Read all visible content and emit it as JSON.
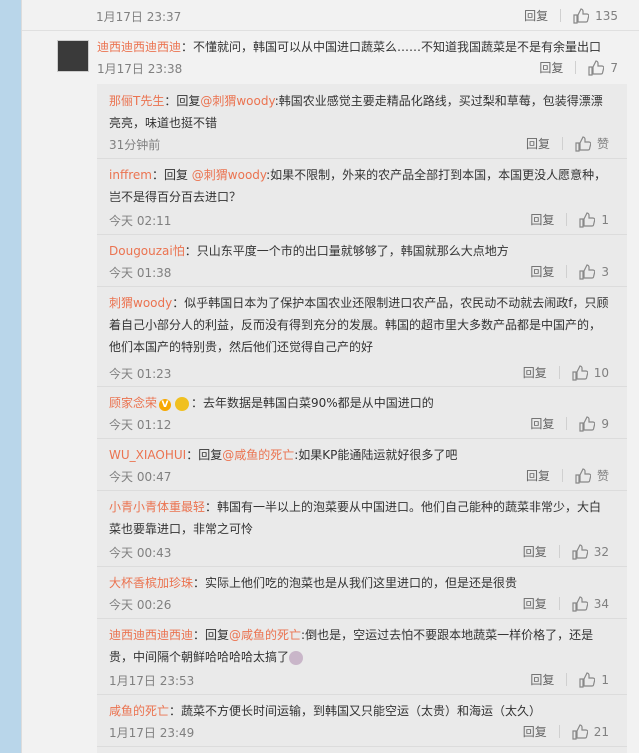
{
  "top": {
    "time": "1月17日 23:37",
    "reply": "回复",
    "likes": "135"
  },
  "main": {
    "user": "迪西迪西迪西迪",
    "text": "：不懂就问，韩国可以从中国进口蔬菜么……不知道我国蔬菜是不是有余量出口",
    "time": "1月17日 23:38",
    "reply": "回复",
    "likes": "7"
  },
  "replies": [
    {
      "user": "那俪T先生",
      "prefix": "：回复",
      "mention": "@刺猬woody",
      "text": ":韩国农业感觉主要走精品化路线，买过梨和草莓，包装得漂漂亮亮，味道也挺不错",
      "time": "31分钟前",
      "reply": "回复",
      "likes": "赞"
    },
    {
      "user": "inffrem",
      "prefix": "：回复 ",
      "mention": "@刺猬woody",
      "text": ":如果不限制，外来的农产品全部打到本国，本国更没人愿意种，岂不是得百分百去进口？",
      "time": "今天 02:11",
      "reply": "回复",
      "likes": "1"
    },
    {
      "user": "Dougouzai怕",
      "prefix": "",
      "mention": "",
      "text": "：只山东平度一个市的出口量就够够了，韩国就那么大点地方",
      "time": "今天 01:38",
      "reply": "回复",
      "likes": "3"
    },
    {
      "user": "刺猬woody",
      "prefix": "",
      "mention": "",
      "text": "：似乎韩国日本为了保护本国农业还限制进口农产品，农民动不动就去闹政f，只顾着自己小部分人的利益，反而没有得到充分的发展。韩国的超市里大多数产品都是中国产的，他们本国产的特别贵，然后他们还觉得自己产的好",
      "time": "今天 01:23",
      "reply": "回复",
      "likes": "10"
    },
    {
      "user": "顾家念荣",
      "prefix": "",
      "mention": "",
      "text": "：去年数据是韩国白菜90%都是从中国进口的",
      "time": "今天 01:12",
      "reply": "回复",
      "likes": "9"
    },
    {
      "user": "WU_XIAOHUI",
      "prefix": "：回复",
      "mention": "@咸鱼的死亡",
      "text": ":如果KP能通陆运就好很多了吧",
      "time": "今天 00:47",
      "reply": "回复",
      "likes": "赞"
    },
    {
      "user": "小青小青体重最轻",
      "prefix": "",
      "mention": "",
      "text": "：韩国有一半以上的泡菜要从中国进口。他们自己能种的蔬菜非常少，大白菜也要靠进口，非常之可怜",
      "time": "今天 00:43",
      "reply": "回复",
      "likes": "32"
    },
    {
      "user": "大杯香槟加珍珠",
      "prefix": "",
      "mention": "",
      "text": "：实际上他们吃的泡菜也是从我们这里进口的，但是还是很贵",
      "time": "今天 00:26",
      "reply": "回复",
      "likes": "34"
    },
    {
      "user": "迪西迪西迪西迪",
      "prefix": "：回复",
      "mention": "@咸鱼的死亡",
      "text": ":倒也是，空运过去怕不要跟本地蔬菜一样价格了，还是贵，中间隔个朝鲜哈哈哈哈太搞了",
      "time": "1月17日 23:53",
      "reply": "回复",
      "likes": "1"
    },
    {
      "user": "咸鱼的死亡",
      "prefix": "",
      "mention": "",
      "text": "：蔬菜不方便长时间运输，到韩国又只能空运（太贵）和海运（太久）",
      "time": "1月17日 23:49",
      "reply": "回复",
      "likes": "21"
    }
  ]
}
